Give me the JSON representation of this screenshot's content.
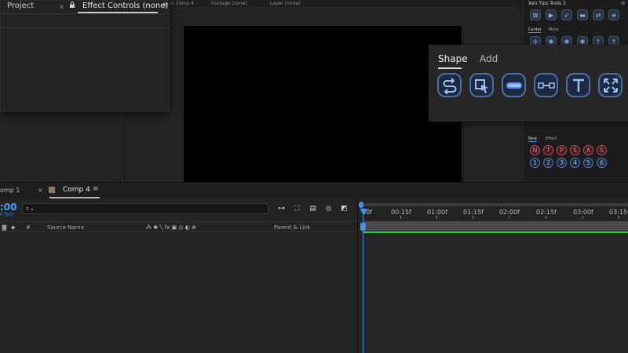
{
  "viewer": {
    "tabs": [
      "n Comp 4",
      "Footage (none)",
      "Layer (none)"
    ]
  },
  "panel": {
    "project_tab": "Project",
    "close_glyph": "×",
    "effect_tab": "Effect Controls (none)",
    "menu_glyph": "≡"
  },
  "xen": {
    "title": "Xen Tips Tools 3",
    "menu_glyph": "≡",
    "tabs_top": [
      "Center",
      "More"
    ],
    "tabs_bottom": [
      "New",
      "Effect"
    ],
    "letters": [
      "N",
      "T",
      "P",
      "S",
      "A",
      "S"
    ],
    "numbers": [
      "1",
      "2",
      "3",
      "4",
      "5",
      "6"
    ]
  },
  "shape_popup": {
    "tabs": [
      "Shape",
      "Add"
    ],
    "buttons": [
      "swap-shape-icon",
      "select-point-icon",
      "rounded-bar-icon",
      "connector-icon",
      "text-icon",
      "expand-icon"
    ]
  },
  "timeline": {
    "tab1": "omp 1",
    "tab1_close": "×",
    "tab2": "Comp 4",
    "tab2_menu": "≡",
    "timecode": ":00",
    "fps": "0 fps)",
    "columns": {
      "hash": "#",
      "source_name": "Source Name",
      "switches": "⁂ ✱ ╲ fx ▣ ◎ ◐ ⊕",
      "parent_link": "Parent & Link"
    },
    "ruler_ticks": [
      "00f",
      "00:15f",
      "01:00f",
      "01:15f",
      "02:00f",
      "02:15f",
      "03:00f",
      "03:15f"
    ]
  }
}
